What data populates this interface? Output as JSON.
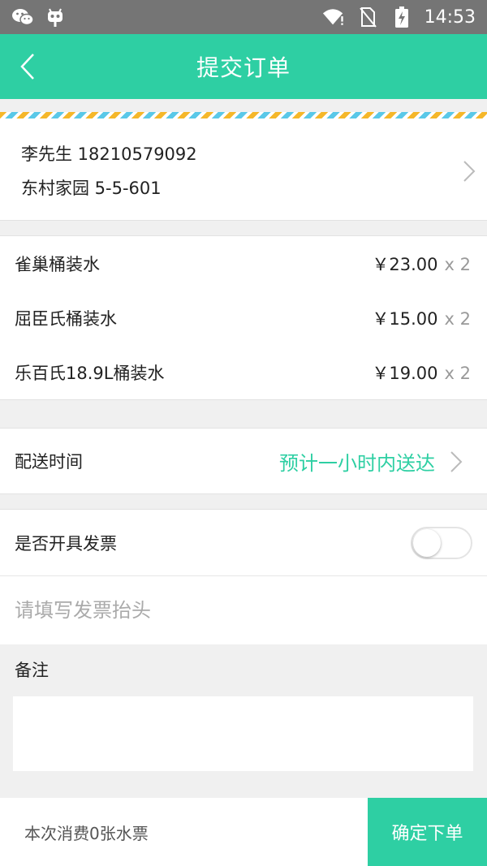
{
  "status_bar": {
    "time": "14:53",
    "left_icons": [
      "wechat-icon",
      "android-icon"
    ],
    "right_icons": [
      "wifi-icon",
      "no-sim-icon",
      "battery-charging-icon"
    ]
  },
  "header": {
    "title": "提交订单",
    "back_icon": "chevron-left-icon",
    "background": "#2ecfa3"
  },
  "address": {
    "name_phone": "李先生 18210579092",
    "detail": "东村家园 5-5-601"
  },
  "items": [
    {
      "name": "雀巢桶装水",
      "price": "￥23.00",
      "qty": "x 2"
    },
    {
      "name": "屈臣氏桶装水",
      "price": "￥15.00",
      "qty": "x 2"
    },
    {
      "name": "乐百氏18.9L桶装水",
      "price": "￥19.00",
      "qty": "x 2"
    }
  ],
  "delivery": {
    "label": "配送时间",
    "value": "预计一小时内送达",
    "value_color": "#2ecfa3"
  },
  "invoice": {
    "label": "是否开具发票",
    "toggle_on": false,
    "header_placeholder": "请填写发票抬头"
  },
  "remarks": {
    "label": "备注",
    "value": ""
  },
  "footer": {
    "consume_text": "本次消费0张水票",
    "submit_label": "确定下单"
  }
}
